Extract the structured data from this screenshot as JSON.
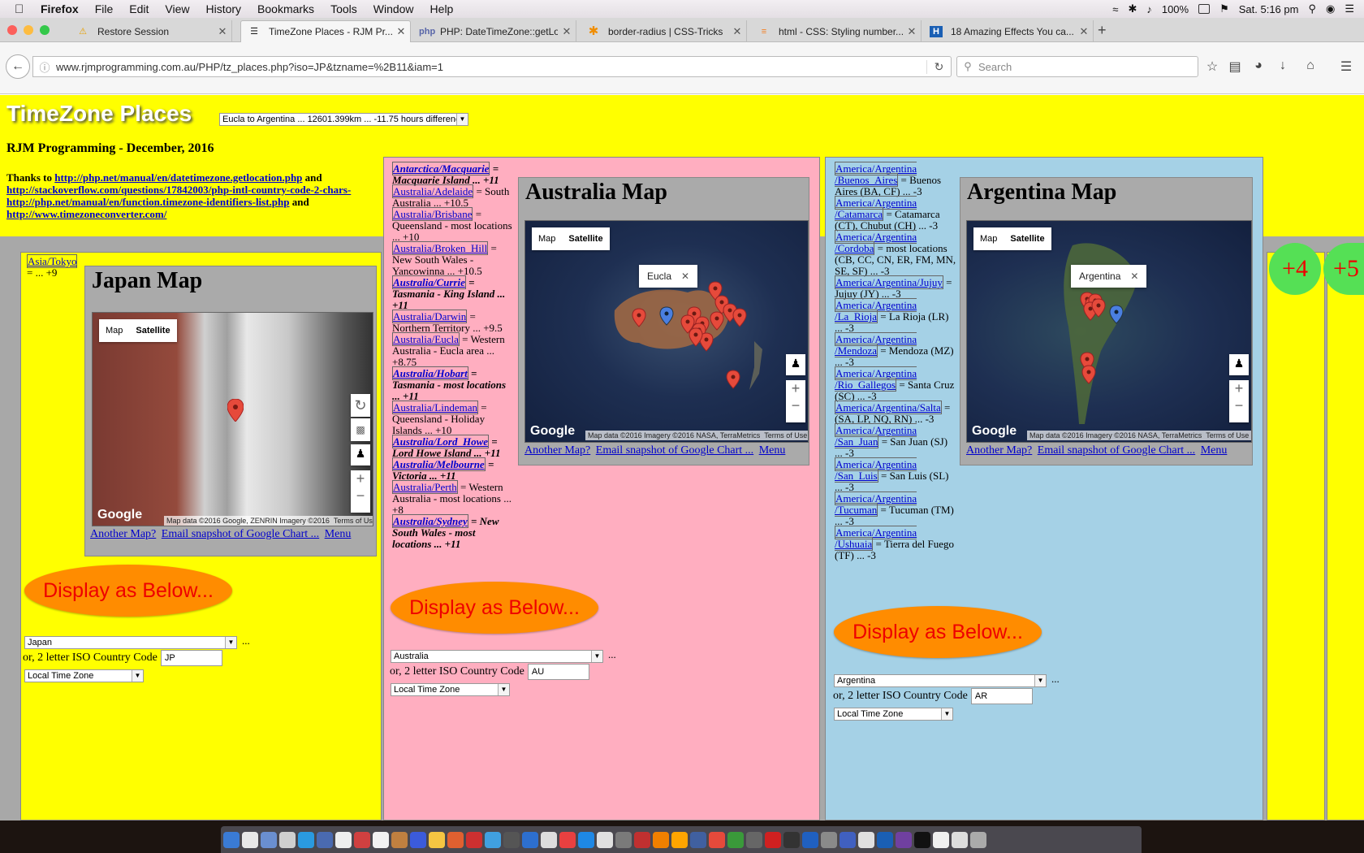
{
  "menubar": {
    "app": "Firefox",
    "items": [
      "File",
      "Edit",
      "View",
      "History",
      "Bookmarks",
      "Tools",
      "Window",
      "Help"
    ],
    "battery": "100%",
    "clock": "Sat. 5:16 pm"
  },
  "tabs": [
    {
      "label": "Restore Session",
      "icon": "warning-icon"
    },
    {
      "label": "TimeZone Places - RJM Pr...",
      "icon": "firefox-page-icon"
    },
    {
      "label": "PHP: DateTimeZone::getLo...",
      "icon": "php-icon"
    },
    {
      "label": "border-radius | CSS-Tricks",
      "icon": "csstricks-icon"
    },
    {
      "label": "html - CSS: Styling number...",
      "icon": "stackoverflow-icon"
    },
    {
      "label": "18 Amazing Effects You ca...",
      "icon": "hongkiat-icon"
    }
  ],
  "nav": {
    "url": "www.rjmprogramming.com.au/PHP/tz_places.php?iso=JP&tzname=%2B11&iam=1",
    "search_placeholder": "Search"
  },
  "page": {
    "title": "TimeZone Places",
    "distance_select": "Eucla to Argentina ... 12601.399km ... -11.75 hours difference",
    "subtitle": "RJM Programming - December, 2016",
    "thanks_prefix": "Thanks to",
    "link1": "http://php.net/manual/en/datetimezone.getlocation.php",
    "and1": "and",
    "link2": "http://stackoverflow.com/questions/17842003/php-intl-country-code-2-chars-",
    "link3": "http://php.net/manual/en/function.timezone-identifiers-list.php",
    "and3": "and",
    "link4": "http://www.timezoneconverter.com/",
    "another_map": "Another Map?",
    "email_snapshot": "Email snapshot of Google Chart ...",
    "menu": "Menu",
    "display_below": "Display as Below...",
    "iso_label": "or, 2 letter ISO Country Code",
    "local_tz": "Local Time Zone",
    "ellipsis": "...",
    "map_btn": "Map",
    "satellite_btn": "Satellite",
    "google": "Google",
    "terms": "Terms of Use"
  },
  "japan": {
    "tz_link": "Asia/Tokyo",
    "tz_rest": "= ... +9",
    "map_title": "Japan Map",
    "mapdata": "Map data ©2016 Google, ZENRIN Imagery ©2016",
    "country_select": "Japan",
    "iso": "JP"
  },
  "australia": {
    "map_title": "Australia Map",
    "infowindow": "Eucla",
    "mapdata": "Map data ©2016 Imagery ©2016 NASA, TerraMetrics",
    "country_select": "Australia",
    "iso": "AU",
    "zones": [
      {
        "link": "Antarctica/Macquarie",
        "desc": "= Macquarie Island ... +11",
        "bold": true
      },
      {
        "link": "Australia/Adelaide",
        "desc": "= South Australia ... +10.5",
        "bold": false
      },
      {
        "link": "Australia/Brisbane",
        "desc": "= Queensland - most locations ... +10",
        "bold": false
      },
      {
        "link": "Australia/Broken_Hill",
        "desc": "= New South Wales - Yancowinna ... +10.5",
        "bold": false
      },
      {
        "link": "Australia/Currie",
        "desc": "= Tasmania - King Island ... +11",
        "bold": true
      },
      {
        "link": "Australia/Darwin",
        "desc": "= Northern Territory ... +9.5",
        "bold": false
      },
      {
        "link": "Australia/Eucla",
        "desc": "= Western Australia - Eucla area ... +8.75",
        "bold": false
      },
      {
        "link": "Australia/Hobart",
        "desc": "= Tasmania - most locations ... +11",
        "bold": true
      },
      {
        "link": "Australia/Lindeman",
        "desc": "= Queensland - Holiday Islands ... +10",
        "bold": false
      },
      {
        "link": "Australia/Lord_Howe",
        "desc": "= Lord Howe Island ... +11",
        "bold": true
      },
      {
        "link": "Australia/Melbourne",
        "desc": "= Victoria ... +11",
        "bold": true
      },
      {
        "link": "Australia/Perth",
        "desc": "= Western Australia - most locations ... +8",
        "bold": false
      },
      {
        "link": "Australia/Sydney",
        "desc": "= New South Wales - most locations ... +11",
        "bold": true
      }
    ]
  },
  "argentina": {
    "map_title": "Argentina Map",
    "infowindow": "Argentina",
    "mapdata": "Map data ©2016 Imagery ©2016 NASA, TerraMetrics",
    "country_select": "Argentina",
    "iso": "AR",
    "zones": [
      {
        "link": "America/Argentina /Buenos_Aires",
        "desc": "= Buenos Aires (BA, CF) ... -3"
      },
      {
        "link": "America/Argentina /Catamarca",
        "desc": "= Catamarca (CT), Chubut (CH) ... -3"
      },
      {
        "link": "America/Argentina /Cordoba",
        "desc": "= most locations (CB, CC, CN, ER, FM, MN, SE, SF) ... -3"
      },
      {
        "link": "America/Argentina/Jujuy",
        "desc": "= Jujuy (JY) ... -3"
      },
      {
        "link": "America/Argentina /La_Rioja",
        "desc": "= La Rioja (LR) ... -3"
      },
      {
        "link": "America/Argentina /Mendoza",
        "desc": "= Mendoza (MZ) ... -3"
      },
      {
        "link": "America/Argentina /Rio_Gallegos",
        "desc": "= Santa Cruz (SC) ... -3"
      },
      {
        "link": "America/Argentina/Salta",
        "desc": "= (SA, LP, NQ, RN) ... -3"
      },
      {
        "link": "America/Argentina /San_Juan",
        "desc": "= San Juan (SJ) ... -3"
      },
      {
        "link": "America/Argentina /San_Luis",
        "desc": "= San Luis (SL) ... -3"
      },
      {
        "link": "America/Argentina /Tucuman",
        "desc": "= Tucuman (TM) ... -3"
      },
      {
        "link": "America/Argentina /Ushuaia",
        "desc": "= Tierra del Fuego (TF) ... -3"
      }
    ]
  },
  "offsets": [
    "+4",
    "+5"
  ],
  "colors": {
    "page_bg": "#ffff00",
    "aus_col": "#ffaec0",
    "arg_col": "#a5d1e6",
    "button_bg": "#ff8c00",
    "button_text": "#ee0000",
    "offset_circle": "#55e055"
  }
}
